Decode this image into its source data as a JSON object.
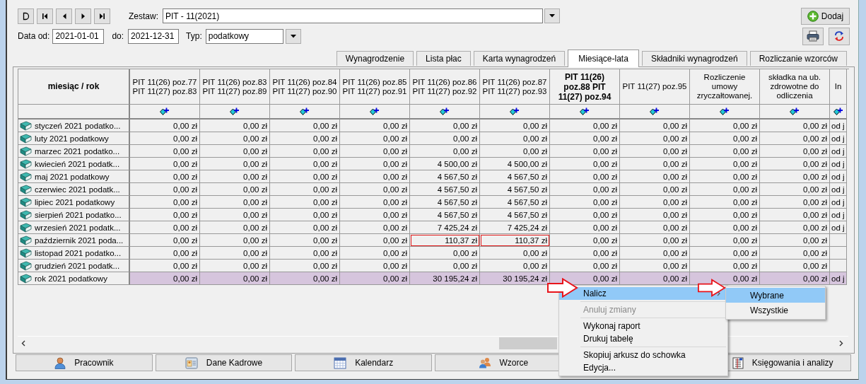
{
  "zestaw": {
    "label": "Zestaw:",
    "value": "PIT - 11(2021)"
  },
  "date_from": {
    "label": "Data od:",
    "value": "2021-01-01"
  },
  "date_to": {
    "label": "do:",
    "value": "2021-12-31"
  },
  "typ": {
    "label": "Typ:",
    "value": "podatkowy"
  },
  "add_button": "Dodaj",
  "tabs": [
    {
      "label": "Wynagrodzenie",
      "selected": false
    },
    {
      "label": "Lista płac",
      "selected": false
    },
    {
      "label": "Karta wynagrodzeń",
      "selected": false
    },
    {
      "label": "Miesiące-lata",
      "selected": true
    },
    {
      "label": "Składniki wynagrodzeń",
      "selected": false
    },
    {
      "label": "Rozliczanie wzorców",
      "selected": false
    }
  ],
  "table": {
    "corner": "miesiąc / rok",
    "columns": [
      {
        "label": "PIT 11(26) poz.77 PIT 11(27) poz.83",
        "bold": false
      },
      {
        "label": "PIT 11(26) poz.83 PIT 11(27) poz.89",
        "bold": false
      },
      {
        "label": "PIT 11(26) poz.84 PIT 11(27) poz.90",
        "bold": false
      },
      {
        "label": "PIT 11(26) poz.85 PIT 11(27) poz.91",
        "bold": false
      },
      {
        "label": "PIT 11(26) poz.86 PIT 11(27) poz.92",
        "bold": false
      },
      {
        "label": "PIT 11(26) poz.87 PIT 11(27) poz.93",
        "bold": false
      },
      {
        "label": "PIT 11(26) poz.88 PIT 11(27) poz.94",
        "bold": true
      },
      {
        "label": "PIT 11(27) poz.95",
        "bold": false
      },
      {
        "label": "Rozliczenie umowy zryczałtowanej.",
        "bold": false
      },
      {
        "label": "składka na ub. zdrowotne do odliczenia",
        "bold": false
      },
      {
        "label": "In",
        "bold": false
      }
    ],
    "rows": [
      {
        "label": "styczeń 2021 podatko...",
        "total": false,
        "cells": [
          {
            "text": "0,00 zł",
            "error": false
          },
          {
            "text": "0,00 zł",
            "error": false
          },
          {
            "text": "0,00 zł",
            "error": false
          },
          {
            "text": "0,00 zł",
            "error": false
          },
          {
            "text": "0,00 zł",
            "error": false
          },
          {
            "text": "0,00 zł",
            "error": false
          },
          {
            "text": "0,00 zł",
            "error": false
          },
          {
            "text": "0,00 zł",
            "error": false
          },
          {
            "text": "0,00 zł",
            "error": false
          },
          {
            "text": "0,00 zł",
            "error": false
          },
          {
            "text": "od j",
            "error": false
          }
        ]
      },
      {
        "label": "luty 2021 podatkowy",
        "total": false,
        "cells": [
          {
            "text": "0,00 zł",
            "error": false
          },
          {
            "text": "0,00 zł",
            "error": false
          },
          {
            "text": "0,00 zł",
            "error": false
          },
          {
            "text": "0,00 zł",
            "error": false
          },
          {
            "text": "0,00 zł",
            "error": false
          },
          {
            "text": "0,00 zł",
            "error": false
          },
          {
            "text": "0,00 zł",
            "error": false
          },
          {
            "text": "0,00 zł",
            "error": false
          },
          {
            "text": "0,00 zł",
            "error": false
          },
          {
            "text": "0,00 zł",
            "error": false
          },
          {
            "text": "od j",
            "error": false
          }
        ]
      },
      {
        "label": "marzec 2021 podatko...",
        "total": false,
        "cells": [
          {
            "text": "0,00 zł",
            "error": false
          },
          {
            "text": "0,00 zł",
            "error": false
          },
          {
            "text": "0,00 zł",
            "error": false
          },
          {
            "text": "0,00 zł",
            "error": false
          },
          {
            "text": "0,00 zł",
            "error": false
          },
          {
            "text": "0,00 zł",
            "error": false
          },
          {
            "text": "0,00 zł",
            "error": false
          },
          {
            "text": "0,00 zł",
            "error": false
          },
          {
            "text": "0,00 zł",
            "error": false
          },
          {
            "text": "0,00 zł",
            "error": false
          },
          {
            "text": "od j",
            "error": false
          }
        ]
      },
      {
        "label": "kwiecień 2021 podatk...",
        "total": false,
        "cells": [
          {
            "text": "0,00 zł",
            "error": false
          },
          {
            "text": "0,00 zł",
            "error": false
          },
          {
            "text": "0,00 zł",
            "error": false
          },
          {
            "text": "0,00 zł",
            "error": false
          },
          {
            "text": "4 500,00 zł",
            "error": false
          },
          {
            "text": "4 500,00 zł",
            "error": false
          },
          {
            "text": "0,00 zł",
            "error": false
          },
          {
            "text": "0,00 zł",
            "error": false
          },
          {
            "text": "0,00 zł",
            "error": false
          },
          {
            "text": "0,00 zł",
            "error": false
          },
          {
            "text": "od j",
            "error": false
          }
        ]
      },
      {
        "label": "maj 2021 podatkowy",
        "total": false,
        "cells": [
          {
            "text": "0,00 zł",
            "error": false
          },
          {
            "text": "0,00 zł",
            "error": false
          },
          {
            "text": "0,00 zł",
            "error": false
          },
          {
            "text": "0,00 zł",
            "error": false
          },
          {
            "text": "4 567,50 zł",
            "error": false
          },
          {
            "text": "4 567,50 zł",
            "error": false
          },
          {
            "text": "0,00 zł",
            "error": false
          },
          {
            "text": "0,00 zł",
            "error": false
          },
          {
            "text": "0,00 zł",
            "error": false
          },
          {
            "text": "0,00 zł",
            "error": false
          },
          {
            "text": "od j",
            "error": false
          }
        ]
      },
      {
        "label": "czerwiec 2021 podatk...",
        "total": false,
        "cells": [
          {
            "text": "0,00 zł",
            "error": false
          },
          {
            "text": "0,00 zł",
            "error": false
          },
          {
            "text": "0,00 zł",
            "error": false
          },
          {
            "text": "0,00 zł",
            "error": false
          },
          {
            "text": "4 567,50 zł",
            "error": false
          },
          {
            "text": "4 567,50 zł",
            "error": false
          },
          {
            "text": "0,00 zł",
            "error": false
          },
          {
            "text": "0,00 zł",
            "error": false
          },
          {
            "text": "0,00 zł",
            "error": false
          },
          {
            "text": "0,00 zł",
            "error": false
          },
          {
            "text": "od j",
            "error": false
          }
        ]
      },
      {
        "label": "lipiec 2021 podatkowy",
        "total": false,
        "cells": [
          {
            "text": "0,00 zł",
            "error": false
          },
          {
            "text": "0,00 zł",
            "error": false
          },
          {
            "text": "0,00 zł",
            "error": false
          },
          {
            "text": "0,00 zł",
            "error": false
          },
          {
            "text": "4 567,50 zł",
            "error": false
          },
          {
            "text": "4 567,50 zł",
            "error": false
          },
          {
            "text": "0,00 zł",
            "error": false
          },
          {
            "text": "0,00 zł",
            "error": false
          },
          {
            "text": "0,00 zł",
            "error": false
          },
          {
            "text": "0,00 zł",
            "error": false
          },
          {
            "text": "od j",
            "error": false
          }
        ]
      },
      {
        "label": "sierpień 2021 podatko...",
        "total": false,
        "cells": [
          {
            "text": "0,00 zł",
            "error": false
          },
          {
            "text": "0,00 zł",
            "error": false
          },
          {
            "text": "0,00 zł",
            "error": false
          },
          {
            "text": "0,00 zł",
            "error": false
          },
          {
            "text": "4 567,50 zł",
            "error": false
          },
          {
            "text": "4 567,50 zł",
            "error": false
          },
          {
            "text": "0,00 zł",
            "error": false
          },
          {
            "text": "0,00 zł",
            "error": false
          },
          {
            "text": "0,00 zł",
            "error": false
          },
          {
            "text": "0,00 zł",
            "error": false
          },
          {
            "text": "od j",
            "error": false
          }
        ]
      },
      {
        "label": "wrzesień 2021 podatk...",
        "total": false,
        "cells": [
          {
            "text": "0,00 zł",
            "error": false
          },
          {
            "text": "0,00 zł",
            "error": false
          },
          {
            "text": "0,00 zł",
            "error": false
          },
          {
            "text": "0,00 zł",
            "error": false
          },
          {
            "text": "7 425,24 zł",
            "error": false
          },
          {
            "text": "7 425,24 zł",
            "error": false
          },
          {
            "text": "0,00 zł",
            "error": false
          },
          {
            "text": "0,00 zł",
            "error": false
          },
          {
            "text": "0,00 zł",
            "error": false
          },
          {
            "text": "0,00 zł",
            "error": false
          },
          {
            "text": "od j",
            "error": false
          }
        ]
      },
      {
        "label": "październik 2021 poda...",
        "total": false,
        "cells": [
          {
            "text": "0,00 zł",
            "error": false
          },
          {
            "text": "0,00 zł",
            "error": false
          },
          {
            "text": "0,00 zł",
            "error": false
          },
          {
            "text": "0,00 zł",
            "error": false
          },
          {
            "text": "110,37 zł",
            "error": true
          },
          {
            "text": "110,37 zł",
            "error": true
          },
          {
            "text": "0,00 zł",
            "error": false
          },
          {
            "text": "0,00 zł",
            "error": false
          },
          {
            "text": "0,00 zł",
            "error": false
          },
          {
            "text": "0,00 zł",
            "error": false
          },
          {
            "error": false
          }
        ]
      },
      {
        "label": "listopad 2021 podatko...",
        "total": false,
        "cells": [
          {
            "text": "0,00 zł",
            "error": false
          },
          {
            "text": "0,00 zł",
            "error": false
          },
          {
            "text": "0,00 zł",
            "error": false
          },
          {
            "text": "0,00 zł",
            "error": false
          },
          {
            "text": "0,00 zł",
            "error": false
          },
          {
            "text": "0,00 zł",
            "error": false
          },
          {
            "text": "0,00 zł",
            "error": false
          },
          {
            "text": "0,00 zł",
            "error": false
          },
          {
            "text": "0,00 zł",
            "error": false
          },
          {
            "text": "0,00 zł",
            "error": false
          },
          {
            "error": false
          }
        ]
      },
      {
        "label": "grudzień 2021 podatk...",
        "total": false,
        "cells": [
          {
            "text": "0,00 zł",
            "error": false
          },
          {
            "text": "0,00 zł",
            "error": false
          },
          {
            "text": "0,00 zł",
            "error": false
          },
          {
            "text": "0,00 zł",
            "error": false
          },
          {
            "text": "0,00 zł",
            "error": false
          },
          {
            "text": "0,00 zł",
            "error": false
          },
          {
            "text": "0,00 zł",
            "error": false
          },
          {
            "text": "0,00 zł",
            "error": false
          },
          {
            "text": "0,00 zł",
            "error": false
          },
          {
            "text": "0,00 zł",
            "error": false
          },
          {
            "error": false
          }
        ]
      },
      {
        "label": "rok 2021 podatkowy",
        "total": true,
        "cells": [
          {
            "text": "0,00 zł",
            "error": false
          },
          {
            "text": "0,00 zł",
            "error": false
          },
          {
            "text": "0,00 zł",
            "error": false
          },
          {
            "text": "0,00 zł",
            "error": false
          },
          {
            "text": "30 195,24 zł",
            "error": false
          },
          {
            "text": "30 195,24 zł",
            "error": false
          },
          {
            "text": "0,00 zł",
            "error": false
          },
          {
            "text": "0,00 zł",
            "error": false
          },
          {
            "text": "0,00 zł",
            "error": false
          },
          {
            "text": "0,00 zł",
            "error": false
          },
          {
            "text": "od j",
            "error": false
          }
        ]
      }
    ]
  },
  "bottom_buttons": [
    "Pracownik",
    "Dane Kadrowe",
    "Kalendarz",
    "Wzorce",
    "Księgowania i analizy"
  ],
  "context_menu": {
    "items": [
      {
        "kind": "submenu",
        "label": "Nalicz",
        "selected": true,
        "disabled": false
      },
      {
        "kind": "separator"
      },
      {
        "kind": "item",
        "label": "Anuluj zmiany",
        "selected": false,
        "disabled": true
      },
      {
        "kind": "separator"
      },
      {
        "kind": "item",
        "label": "Wykonaj raport",
        "selected": false,
        "disabled": false
      },
      {
        "kind": "item",
        "label": "Drukuj tabelę",
        "selected": false,
        "disabled": false
      },
      {
        "kind": "separator"
      },
      {
        "kind": "item",
        "label": "Skopiuj arkusz do schowka",
        "selected": false,
        "disabled": false
      },
      {
        "kind": "item",
        "label": "Edycja...",
        "selected": false,
        "disabled": false
      }
    ],
    "submenu": [
      {
        "label": "Wybrane",
        "selected": true
      },
      {
        "label": "Wszystkie",
        "selected": false
      }
    ]
  }
}
